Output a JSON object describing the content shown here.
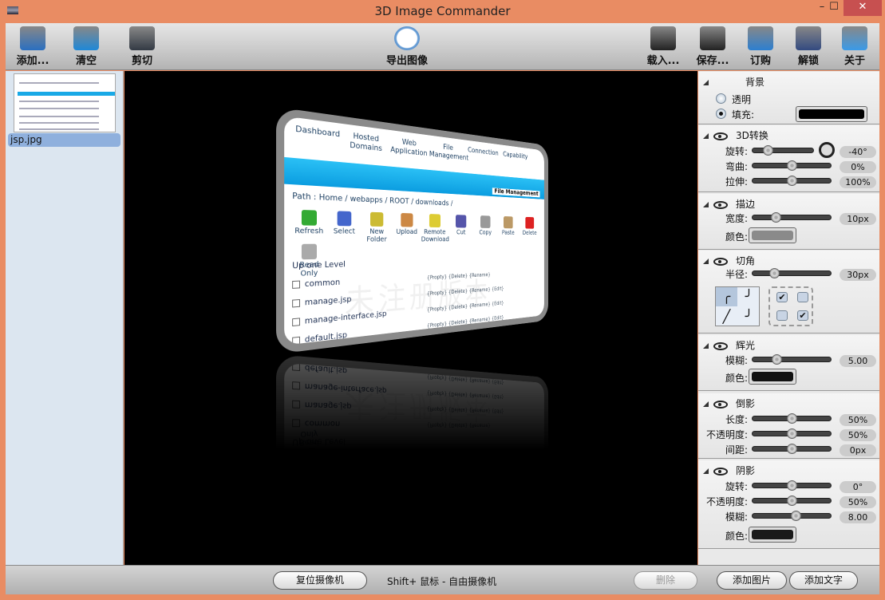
{
  "window": {
    "title": "3D Image Commander",
    "minimize": "–",
    "maximize": "☐",
    "close": "✕"
  },
  "toolbar": {
    "left": [
      {
        "label": "添加...",
        "icon": "add-image-icon",
        "color": "#2a6fc0"
      },
      {
        "label": "清空",
        "icon": "clear-icon",
        "color": "#1e88d8"
      },
      {
        "label": "剪切",
        "icon": "crop-icon",
        "color": "#333a44"
      }
    ],
    "center": {
      "label": "导出图像",
      "icon": "clock-export-icon"
    },
    "right": [
      {
        "label": "载入...",
        "icon": "load-icon",
        "color": "#222"
      },
      {
        "label": "保存...",
        "icon": "save-icon",
        "color": "#222"
      },
      {
        "label": "订购",
        "icon": "order-icon",
        "color": "#2c7fd0"
      },
      {
        "label": "解锁",
        "icon": "unlock-icon",
        "color": "#334a80"
      },
      {
        "label": "关于",
        "icon": "about-user-icon",
        "color": "#3a9ae8"
      }
    ]
  },
  "files": [
    {
      "name": "jsp.jpg",
      "selected": true
    }
  ],
  "preview": {
    "nav": [
      "Dashboard",
      "Hosted Domains",
      "Web Application",
      "File Management",
      "Connection",
      "Capability"
    ],
    "banner": "File Management",
    "path": "Path : Home / webapps / ROOT / downloads /",
    "tools": [
      "Refresh",
      "Select",
      "New Folder",
      "Upload",
      "Remote Download",
      "Cut",
      "Copy",
      "Paste",
      "Delete",
      "Read Only"
    ],
    "up": "Up one Level",
    "rows": [
      {
        "name": "common",
        "actions": "{Propty}   {Delete} {Rename}"
      },
      {
        "name": "manage.jsp",
        "actions": "{Propty}   {Delete} {Rename} {Edit}"
      },
      {
        "name": "manage-interface.jsp",
        "actions": "{Propty}   {Delete} {Rename} {Edit}"
      },
      {
        "name": "default.jsp",
        "actions": "{Propty}   {Delete} {Rename} {Edit}"
      }
    ],
    "watermark": "未注册版本"
  },
  "panel": {
    "background": {
      "title": "背景",
      "transparent": "透明",
      "fill": "填充:",
      "fill_selected": true,
      "fill_color": "#000000"
    },
    "transform": {
      "title": "3D转换",
      "rotate": {
        "label": "旋转:",
        "value": "-40°",
        "position": 0.25
      },
      "bend": {
        "label": "弯曲:",
        "value": "0%",
        "position": 0.5
      },
      "stretch": {
        "label": "拉伸:",
        "value": "100%",
        "position": 0.5
      }
    },
    "stroke": {
      "title": "描边",
      "width": {
        "label": "宽度:",
        "value": "10px",
        "position": 0.3
      },
      "color_label": "颜色:",
      "color": "#8a8a8a"
    },
    "corner": {
      "title": "切角",
      "radius": {
        "label": "半径:",
        "value": "30px",
        "position": 0.28
      },
      "styles": [
        "╭",
        "╯",
        "╱",
        "╯"
      ],
      "checks": [
        "✔",
        "",
        "",
        "✔"
      ]
    },
    "glow": {
      "title": "辉光",
      "blur": {
        "label": "模糊:",
        "value": "5.00",
        "position": 0.31
      },
      "color_label": "颜色:",
      "color": "#111111"
    },
    "reflection": {
      "title": "倒影",
      "length": {
        "label": "长度:",
        "value": "50%",
        "position": 0.5
      },
      "opacity": {
        "label": "不透明度:",
        "value": "50%",
        "position": 0.5
      },
      "gap": {
        "label": "间距:",
        "value": "0px",
        "position": 0.5
      }
    },
    "shadow": {
      "title": "阴影",
      "rotate": {
        "label": "旋转:",
        "value": "0°",
        "position": 0.5
      },
      "opacity": {
        "label": "不透明度:",
        "value": "50%",
        "position": 0.5
      },
      "blur": {
        "label": "模糊:",
        "value": "8.00",
        "position": 0.55
      },
      "color_label": "颜色:",
      "color": "#1a1a1a"
    }
  },
  "bottom": {
    "reset_camera": "复位摄像机",
    "hint": "Shift+ 鼠标 - 自由摄像机",
    "delete": "删除",
    "add_image": "添加图片",
    "add_text": "添加文字"
  }
}
